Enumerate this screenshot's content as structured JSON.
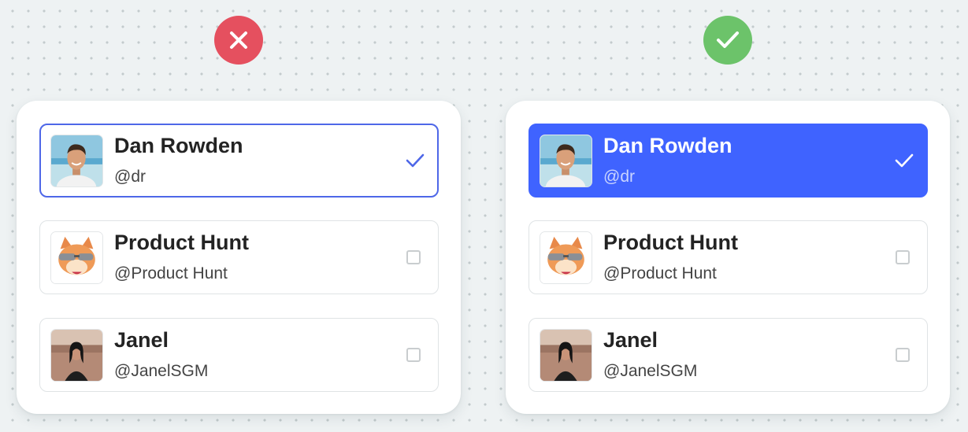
{
  "verdicts": {
    "bad": {
      "icon": "x-icon",
      "color": "#e5505f"
    },
    "good": {
      "icon": "checkmark-icon",
      "color": "#6cc36a"
    }
  },
  "accent": "#3f63ff",
  "examples": {
    "left": {
      "selected_style": "outline",
      "items": [
        {
          "name": "Dan Rowden",
          "handle": "@dr",
          "selected": true,
          "avatar": "avatar-dan-rowden"
        },
        {
          "name": "Product Hunt",
          "handle": "@Product Hunt",
          "selected": false,
          "avatar": "avatar-product-hunt-cat"
        },
        {
          "name": "Janel",
          "handle": "@JanelSGM",
          "selected": false,
          "avatar": "avatar-janel"
        }
      ]
    },
    "right": {
      "selected_style": "filled",
      "items": [
        {
          "name": "Dan Rowden",
          "handle": "@dr",
          "selected": true,
          "avatar": "avatar-dan-rowden"
        },
        {
          "name": "Product Hunt",
          "handle": "@Product Hunt",
          "selected": false,
          "avatar": "avatar-product-hunt-cat"
        },
        {
          "name": "Janel",
          "handle": "@JanelSGM",
          "selected": false,
          "avatar": "avatar-janel"
        }
      ]
    }
  }
}
